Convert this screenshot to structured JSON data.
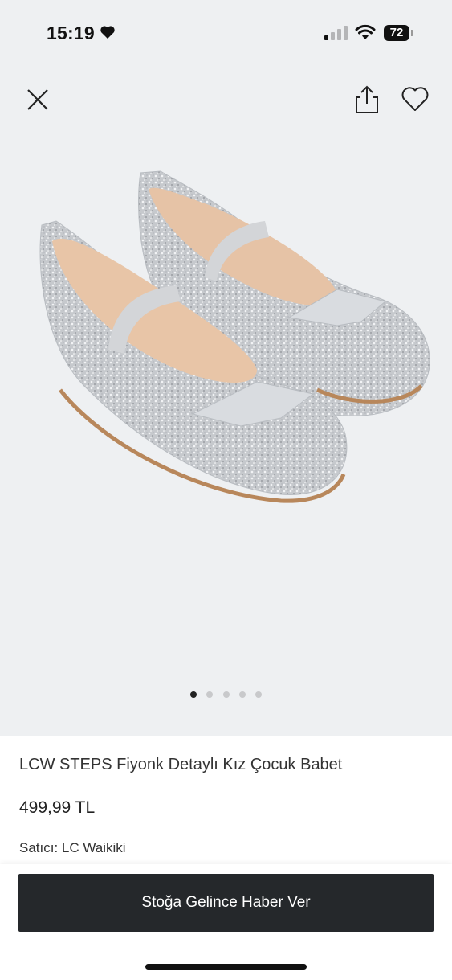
{
  "status_bar": {
    "time": "15:19",
    "battery": "72",
    "icons": [
      "heart-icon",
      "signal-icon",
      "wifi-icon",
      "battery-icon"
    ]
  },
  "gallery": {
    "image_count": 5,
    "active_index": 0,
    "icons": {
      "close": "close-icon",
      "share": "share-icon",
      "favorite": "heart-outline-icon"
    }
  },
  "product": {
    "title": "LCW STEPS Fiyonk Detaylı Kız Çocuk Babet",
    "price": "499,99 TL",
    "seller": "Satıcı: LC Waikiki"
  },
  "actions": {
    "notify_label": "Stoğa Gelince Haber Ver"
  },
  "colors": {
    "background": "#eef0f2",
    "button": "#25282b",
    "button_text": "#ffffff"
  }
}
